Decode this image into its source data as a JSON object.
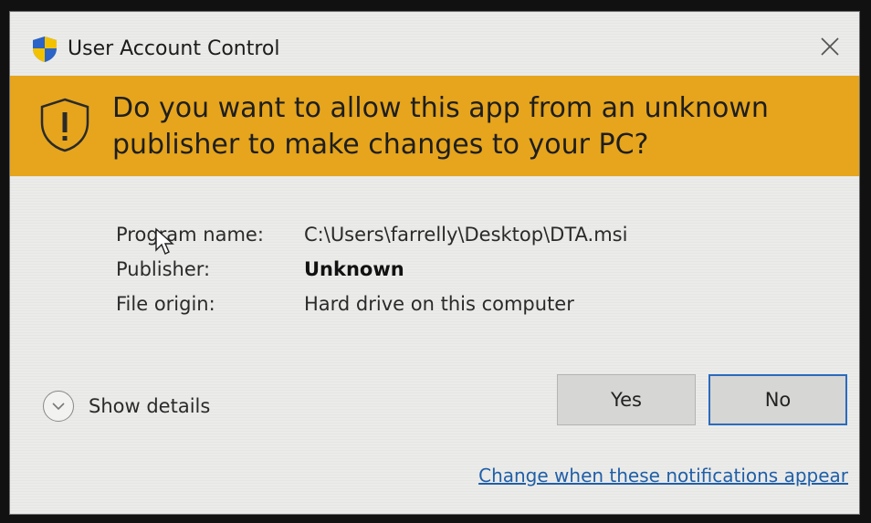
{
  "window": {
    "title": "User Account Control",
    "close_glyph": "✕"
  },
  "banner": {
    "question": "Do you want to allow this app from an unknown publisher to make changes to your PC?",
    "color": "#e6a51d",
    "icon": "shield-warning-icon"
  },
  "details": [
    {
      "label": "Program name:",
      "value": "C:\\Users\\farrelly\\Desktop\\DTA.msi",
      "bold": false
    },
    {
      "label": "Publisher:",
      "value": "Unknown",
      "bold": true
    },
    {
      "label": "File origin:",
      "value": "Hard drive on this computer",
      "bold": false
    }
  ],
  "show_details": {
    "label": "Show details",
    "icon": "chevron-down-icon"
  },
  "buttons": {
    "yes_label": "Yes",
    "no_label": "No",
    "focus_color": "#2a6bbd"
  },
  "footer": {
    "link_text": "Change when these notifications appear",
    "link_color": "#1f5fa8"
  }
}
